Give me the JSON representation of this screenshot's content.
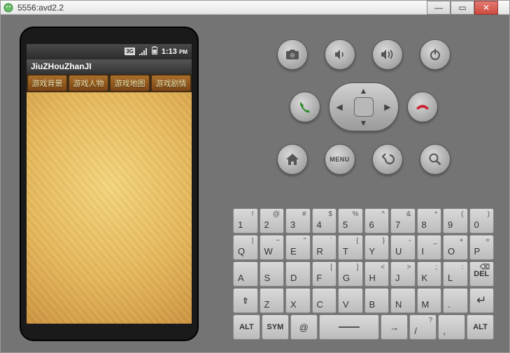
{
  "window": {
    "title": "5556:avd2.2"
  },
  "win_buttons": {
    "min": "—",
    "max": "▭",
    "close": "✕"
  },
  "phone": {
    "status": {
      "clock": "1:13",
      "ampm": "PM"
    },
    "app_title": "JiuZHouZhanJI",
    "tabs": [
      "游戏背景",
      "游戏人物",
      "游戏地图",
      "游戏剧情"
    ]
  },
  "controls": {
    "camera": "camera-icon",
    "vol_down": "volume-down-icon",
    "vol_up": "volume-up-icon",
    "power": "power-icon",
    "call": "call-icon",
    "end": "end-call-icon",
    "home": "home-icon",
    "menu_label": "MENU",
    "back": "back-icon",
    "search": "search-icon"
  },
  "keyboard": {
    "row1": [
      {
        "p": "1",
        "s": "!"
      },
      {
        "p": "2",
        "s": "@"
      },
      {
        "p": "3",
        "s": "#"
      },
      {
        "p": "4",
        "s": "$"
      },
      {
        "p": "5",
        "s": "%"
      },
      {
        "p": "6",
        "s": "^"
      },
      {
        "p": "7",
        "s": "&"
      },
      {
        "p": "8",
        "s": "*"
      },
      {
        "p": "9",
        "s": "("
      },
      {
        "p": "0",
        "s": ")"
      }
    ],
    "row2": [
      {
        "p": "Q",
        "s": "|"
      },
      {
        "p": "W",
        "s": "~"
      },
      {
        "p": "E",
        "s": "\""
      },
      {
        "p": "R",
        "s": "`"
      },
      {
        "p": "T",
        "s": "{"
      },
      {
        "p": "Y",
        "s": "}"
      },
      {
        "p": "U",
        "s": "-"
      },
      {
        "p": "I",
        "s": "_"
      },
      {
        "p": "O",
        "s": "+"
      },
      {
        "p": "P",
        "s": "="
      }
    ],
    "row3": [
      {
        "p": "A",
        "s": ""
      },
      {
        "p": "S",
        "s": ""
      },
      {
        "p": "D",
        "s": ""
      },
      {
        "p": "F",
        "s": "["
      },
      {
        "p": "G",
        "s": "]"
      },
      {
        "p": "H",
        "s": "<"
      },
      {
        "p": "J",
        "s": ">"
      },
      {
        "p": "K",
        "s": ";"
      },
      {
        "p": "L",
        "s": ":"
      }
    ],
    "row3_del": {
      "p": "DEL",
      "s": ""
    },
    "row4_shift": "⇧",
    "row4": [
      {
        "p": "Z",
        "s": ""
      },
      {
        "p": "X",
        "s": ""
      },
      {
        "p": "C",
        "s": ""
      },
      {
        "p": "V",
        "s": ""
      },
      {
        "p": "B",
        "s": ""
      },
      {
        "p": "N",
        "s": ""
      },
      {
        "p": "M",
        "s": ""
      },
      {
        "p": ".",
        "s": ""
      }
    ],
    "row4_enter": "↵",
    "row5": {
      "alt_l": "ALT",
      "sym": "SYM",
      "at": "@",
      "space": "—",
      "arrow": "→",
      "slash": {
        "p": "/",
        "s": "?"
      },
      "comma": {
        "p": ",",
        "s": ""
      },
      "alt_r": "ALT"
    }
  }
}
